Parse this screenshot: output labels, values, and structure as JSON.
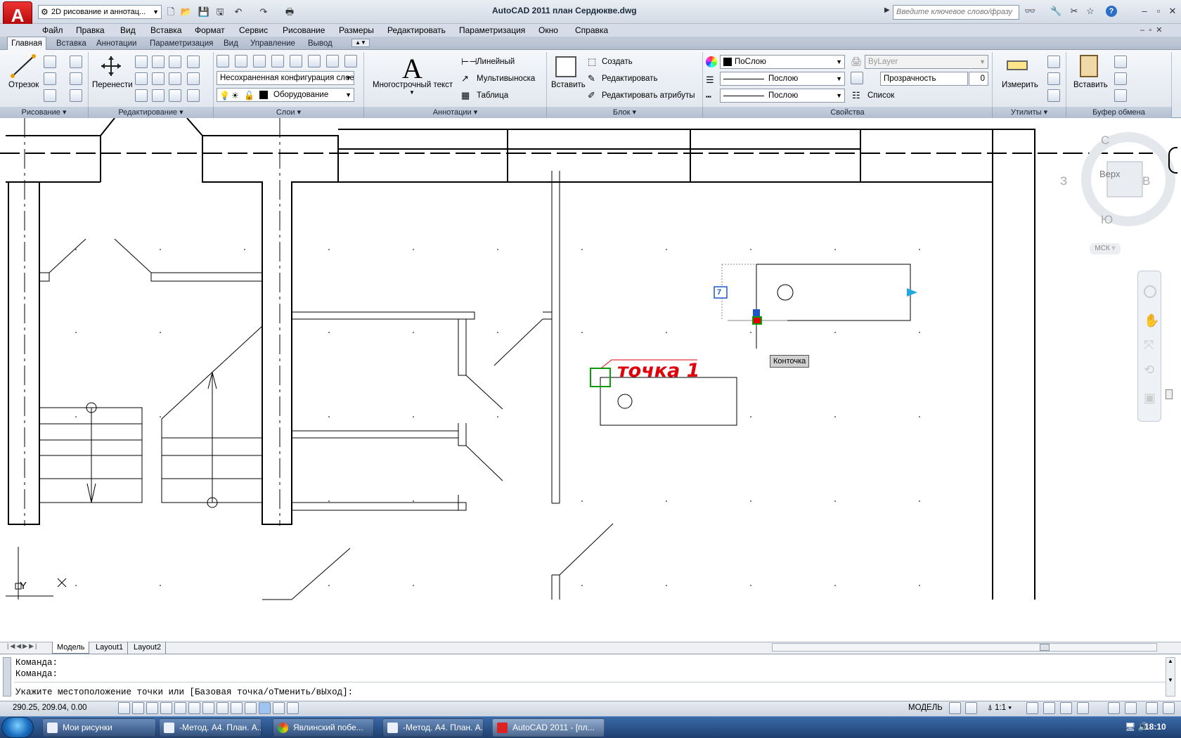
{
  "app": {
    "logo": "A",
    "title": "AutoCAD 2011     план Сердюкве.dwg"
  },
  "workspace": {
    "value": "2D рисование и аннотац...",
    "icon": "gear-icon"
  },
  "search": {
    "placeholder": "Введите ключевое слово/фразу"
  },
  "menu": [
    "Файл",
    "Правка",
    "Вид",
    "Вставка",
    "Формат",
    "Сервис",
    "Рисование",
    "Размеры",
    "Редактировать",
    "Параметризация",
    "Окно",
    "Справка"
  ],
  "ribbon_tabs": [
    "Главная",
    "Вставка",
    "Аннотации",
    "Параметризация",
    "Вид",
    "Управление",
    "Вывод"
  ],
  "ribbon": {
    "draw": {
      "line": "Отрезок",
      "title": "Рисование"
    },
    "modify": {
      "move": "Перенести",
      "title": "Редактирование"
    },
    "layers": {
      "state": "Несохраненная конфигурация слоев",
      "current": "Оборудование",
      "title": "Слои"
    },
    "annotation": {
      "mtext": "Многострочный текст",
      "linear": "Линейный",
      "mleader": "Мультивыноска",
      "table": "Таблица",
      "title": "Аннотации"
    },
    "block": {
      "insert": "Вставить",
      "create": "Создать",
      "edit": "Редактировать",
      "edit_attr": "Редактировать атрибуты",
      "title": "Блок"
    },
    "properties": {
      "color": "ПоСлою",
      "linetype": "Послою",
      "lineweight": "Послою",
      "plotstyle": "ByLayer",
      "transparency": "Прозрачность",
      "transparency_value": "0",
      "list": "Список",
      "title": "Свойства"
    },
    "utilities": {
      "measure": "Измерить",
      "title": "Утилиты"
    },
    "clipboard": {
      "paste": "Вставить",
      "title": "Буфер обмена"
    }
  },
  "drawing": {
    "annotation": "точка 1",
    "osnap_tooltip": "Конточка",
    "dyn_input": "7",
    "ucs": {
      "x": "X",
      "y": "Y"
    }
  },
  "viewcube": {
    "n": "С",
    "s": "Ю",
    "w": "З",
    "e": "В",
    "face": "Верх",
    "wcs": "МСК"
  },
  "layout_tabs": [
    "Модель",
    "Layout1",
    "Layout2"
  ],
  "command": {
    "line1": "Команда:",
    "line2": "Команда:",
    "prompt": "Укажите местоположение точки или [Базовая точка/оТменить/вЫход]:"
  },
  "status": {
    "coords": "290.25, 209.04, 0.00",
    "mode": "МОДЕЛЬ",
    "scale": "1:1"
  },
  "taskbar": {
    "items": [
      "Мои рисунки",
      "-Метод. А4. План. А...",
      "Явлинский побе...",
      "-Метод. А4. План. А...",
      "AutoCAD 2011 - [пл..."
    ],
    "clock": "18:10"
  },
  "colors": {
    "annotation": "#e0000a",
    "accent": "#0078d7",
    "ribbon_bg": "#dfe5ee"
  }
}
